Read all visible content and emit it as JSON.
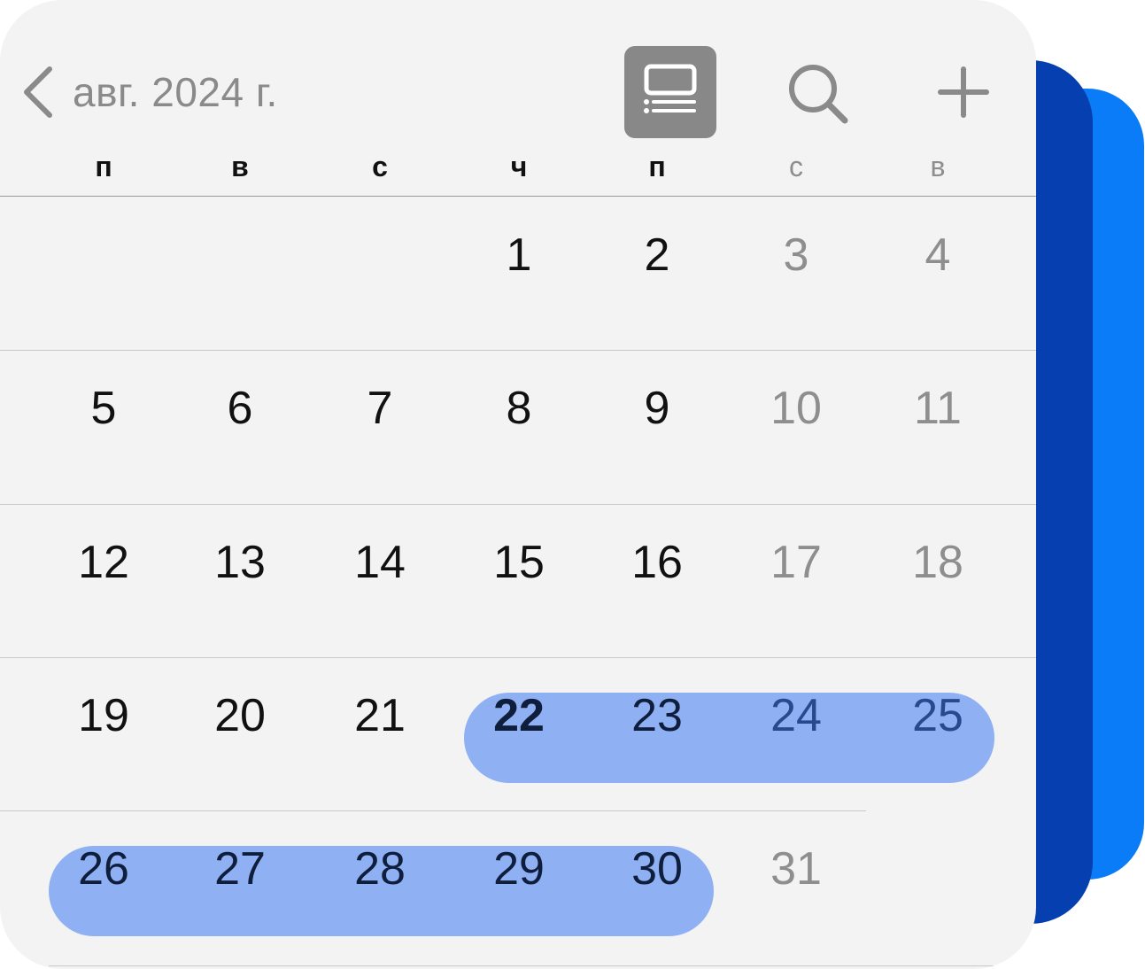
{
  "header": {
    "month_title": "авг. 2024 г."
  },
  "weekdays": [
    {
      "label": "п",
      "weekend": false
    },
    {
      "label": "в",
      "weekend": false
    },
    {
      "label": "с",
      "weekend": false
    },
    {
      "label": "ч",
      "weekend": false
    },
    {
      "label": "п",
      "weekend": false
    },
    {
      "label": "с",
      "weekend": true
    },
    {
      "label": "в",
      "weekend": true
    }
  ],
  "weeks": [
    [
      "",
      "",
      "",
      "1",
      "2",
      "3",
      "4"
    ],
    [
      "5",
      "6",
      "7",
      "8",
      "9",
      "10",
      "11"
    ],
    [
      "12",
      "13",
      "14",
      "15",
      "16",
      "17",
      "18"
    ],
    [
      "19",
      "20",
      "21",
      "22",
      "23",
      "24",
      "25"
    ],
    [
      "26",
      "27",
      "28",
      "29",
      "30",
      "31",
      ""
    ]
  ],
  "selected_range": {
    "start": "22",
    "end": "30"
  },
  "today": "22",
  "colors": {
    "range_fill": "#8fb0f3",
    "accent_dark": "#063faf",
    "accent_light": "#0a7cf7",
    "weekend_text": "#8e8e8e",
    "header_text": "#8a8a8a",
    "active_button": "#888888"
  },
  "icons": {
    "back": "chevron-left-icon",
    "list_view": "list-view-icon",
    "search": "search-icon",
    "add": "plus-icon"
  }
}
